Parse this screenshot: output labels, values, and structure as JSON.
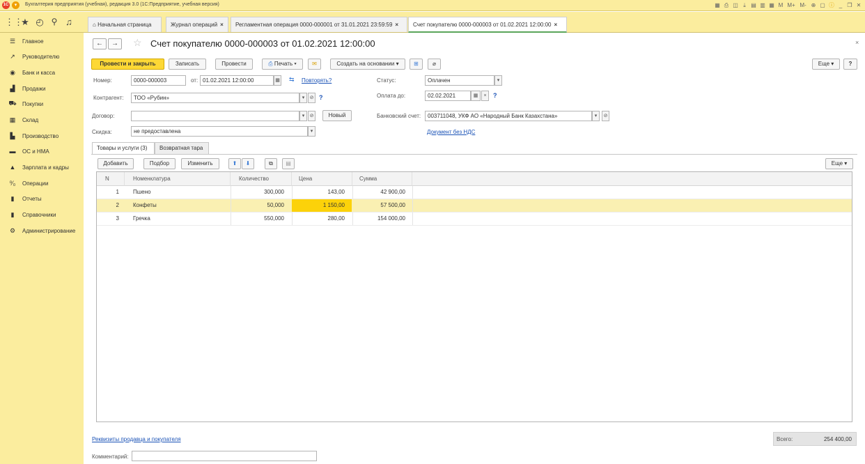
{
  "window": {
    "title": "Бухгалтерия предприятия (учебная), редакция 3.0  (1С:Предприятие, учебная версия)",
    "logo": "1С"
  },
  "titlebar_buttons": [
    "M",
    "M+",
    "M-"
  ],
  "tabs": [
    {
      "label": "Начальная страница"
    },
    {
      "label": "Журнал операций"
    },
    {
      "label": "Регламентная операция 0000-000001 от 31.01.2021 23:59:59"
    },
    {
      "label": "Счет покупателю 0000-000003 от 01.02.2021 12:00:00"
    }
  ],
  "sidebar": {
    "items": [
      {
        "label": "Главное",
        "icon": "menu-icon"
      },
      {
        "label": "Руководителю",
        "icon": "trend-icon"
      },
      {
        "label": "Банк и касса",
        "icon": "bank-icon"
      },
      {
        "label": "Продажи",
        "icon": "bag-icon"
      },
      {
        "label": "Покупки",
        "icon": "cart-icon"
      },
      {
        "label": "Склад",
        "icon": "warehouse-icon"
      },
      {
        "label": "Производство",
        "icon": "factory-icon"
      },
      {
        "label": "ОС и НМА",
        "icon": "truck-icon"
      },
      {
        "label": "Зарплата и кадры",
        "icon": "person-icon"
      },
      {
        "label": "Операции",
        "icon": "operations-icon"
      },
      {
        "label": "Отчеты",
        "icon": "chart-icon"
      },
      {
        "label": "Справочники",
        "icon": "book-icon"
      },
      {
        "label": "Администрирование",
        "icon": "gear-icon"
      }
    ]
  },
  "document": {
    "title": "Счет покупателю 0000-000003 от 01.02.2021 12:00:00",
    "buttons": {
      "post_close": "Провести и закрыть",
      "save": "Записать",
      "post": "Провести",
      "print": "Печать",
      "create_based": "Создать на основании",
      "more": "Еще",
      "help": "?"
    },
    "fields": {
      "number_label": "Номер:",
      "number": "0000-000003",
      "date_label": "от:",
      "date": "01.02.2021 12:00:00",
      "repeat_link": "Повторять?",
      "status_label": "Статус:",
      "status": "Оплачен",
      "counterparty_label": "Контрагент:",
      "counterparty": "ТОО «Рубин»",
      "pay_until_label": "Оплата до:",
      "pay_until": "02.02.2021",
      "contract_label": "Договор:",
      "contract": "",
      "new_button": "Новый",
      "bank_account_label": "Банковский счет:",
      "bank_account": "003711048, УКФ АО «Народный Банк Казахстана»",
      "discount_label": "Скидка:",
      "discount": "не предоставлена",
      "vat_link": "Документ без НДС"
    },
    "form_tabs": [
      {
        "label": "Товары и услуги (3)"
      },
      {
        "label": "Возвратная тара"
      }
    ],
    "table_buttons": {
      "add": "Добавить",
      "select": "Подбор",
      "change": "Изменить",
      "more": "Еще"
    },
    "table": {
      "columns": [
        "N",
        "Номенклатура",
        "Количество",
        "Цена",
        "Сумма"
      ],
      "rows": [
        {
          "n": "1",
          "item": "Пшено",
          "qty": "300,000",
          "price": "143,00",
          "sum": "42 900,00"
        },
        {
          "n": "2",
          "item": "Конфеты",
          "qty": "50,000",
          "price": "1 150,00",
          "sum": "57 500,00"
        },
        {
          "n": "3",
          "item": "Гречка",
          "qty": "550,000",
          "price": "280,00",
          "sum": "154 000,00"
        }
      ]
    },
    "footer": {
      "requisites_link": "Реквизиты продавца и покупателя",
      "total_label": "Всего:",
      "total": "254 400,00",
      "comment_label": "Комментарий:",
      "comment": ""
    }
  },
  "colors": {
    "panel": "#fbed9e",
    "primary_button": "#fdd835",
    "selected_row": "#faf0b2",
    "link": "#1a52b6"
  }
}
